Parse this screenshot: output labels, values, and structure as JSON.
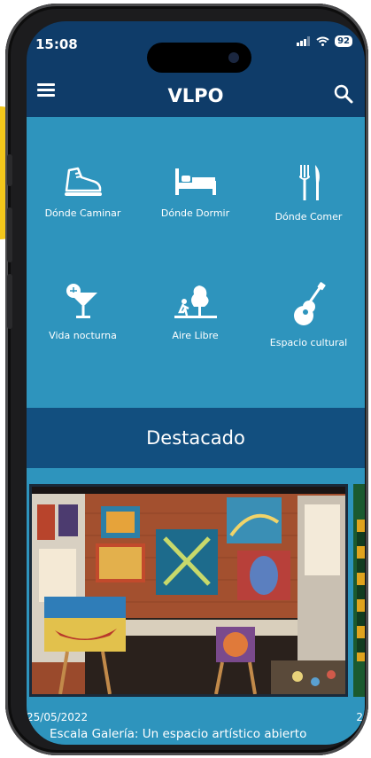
{
  "status_bar": {
    "time": "15:08",
    "battery": "92",
    "signal": "signal-icon",
    "wifi": "wifi-icon"
  },
  "header": {
    "title": "VLPO",
    "menu_icon": "menu-icon",
    "search_icon": "search-icon"
  },
  "categories": [
    {
      "label": "Dónde Caminar",
      "icon": "shoe-icon"
    },
    {
      "label": "Dónde Dormir",
      "icon": "bed-icon"
    },
    {
      "label": "Dónde Comer",
      "icon": "cutlery-icon"
    },
    {
      "label": "Vida nocturna",
      "icon": "cocktail-icon"
    },
    {
      "label": "Aire Libre",
      "icon": "outdoor-icon"
    },
    {
      "label": "Espacio cultural",
      "icon": "guitar-icon"
    }
  ],
  "featured": {
    "heading": "Destacado",
    "cards": [
      {
        "date": "25/05/2022",
        "title": "Escala Galería: Un espacio artístico abierto",
        "image": "gallery-photo"
      },
      {
        "date": "2",
        "title": "",
        "image": "next-card-photo"
      }
    ]
  },
  "colors": {
    "header_blue": "#0f3c69",
    "grid_blue": "#2e94bd",
    "banner_blue": "#124f7f"
  }
}
